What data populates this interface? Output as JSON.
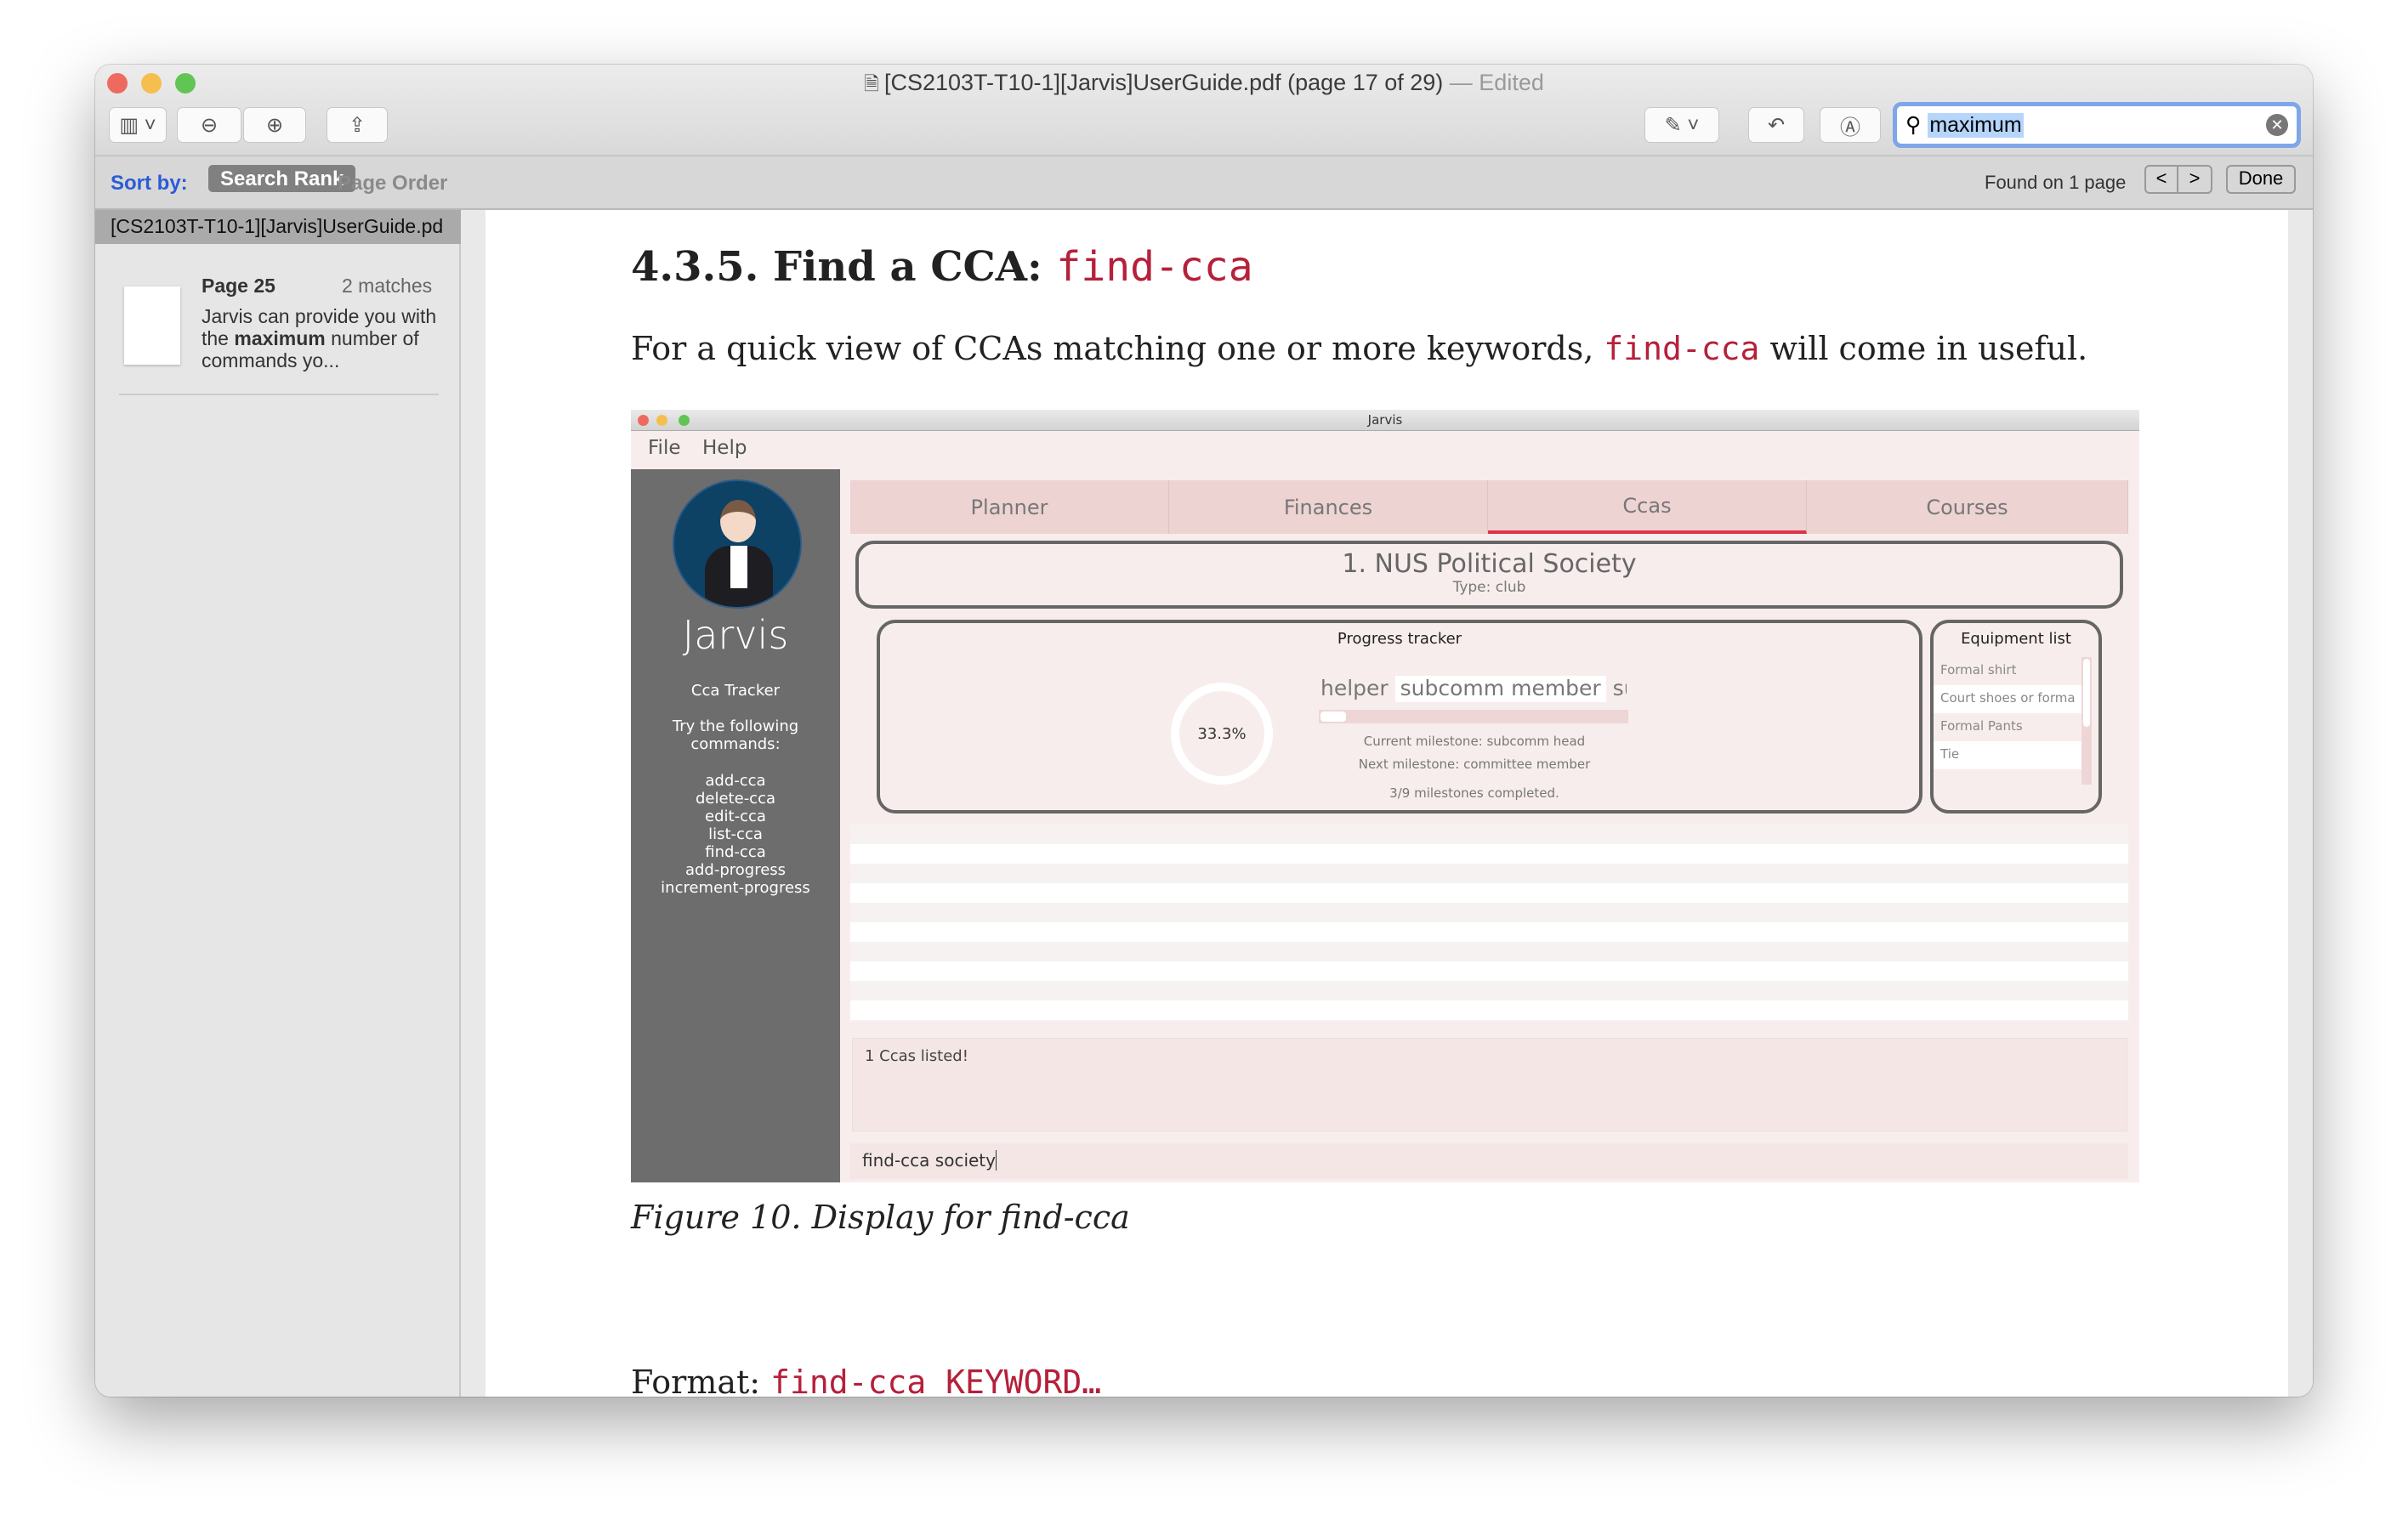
{
  "window": {
    "title": "[CS2103T-T10-1][Jarvis]UserGuide.pdf (page 17 of 29)",
    "edited": "— Edited"
  },
  "toolbar": {
    "icons": [
      "sidebar-icon",
      "zoom-out-icon",
      "zoom-in-icon",
      "share-icon",
      "markup-pen-icon",
      "rotate-icon",
      "annotate-icon"
    ]
  },
  "search": {
    "value": "maximum"
  },
  "sortbar": {
    "label": "Sort by:",
    "search_rank": "Search Rank",
    "page_order": "Page Order",
    "found": "Found on 1 page",
    "prev": "<",
    "next": ">",
    "done": "Done"
  },
  "sidebar": {
    "file": "[CS2103T-T10-1][Jarvis]UserGuide.pd",
    "results": [
      {
        "page": "Page 25",
        "matches": "2 matches",
        "pre": "Jarvis can provide you with the ",
        "hit": "maximum",
        "post": " number of commands yo..."
      }
    ]
  },
  "doc": {
    "heading": "4.3.5. Find a CCA: ",
    "heading_code": "find-cca",
    "para_pre": "For a quick view of CCAs matching one or more keywords, ",
    "para_code": "find-cca",
    "para_post": " will come in useful.",
    "caption": "Figure 10. Display for find-cca",
    "format_label": "Format: ",
    "format_code": "find-cca KEYWORD…"
  },
  "jarvis": {
    "title": "Jarvis",
    "menu": [
      "File",
      "Help"
    ],
    "app_name": "Jarvis",
    "section": "Cca Tracker",
    "hint": [
      "Try the following",
      "commands:"
    ],
    "commands": [
      "add-cca",
      "delete-cca",
      "edit-cca",
      "list-cca",
      "find-cca",
      "add-progress",
      "increment-progress"
    ],
    "tabs": [
      "Planner",
      "Finances",
      "Ccas",
      "Courses"
    ],
    "active_tab": "Ccas",
    "accent": "#e0314b",
    "cca_name": "1.  NUS Political Society",
    "cca_type": "Type: club",
    "progress": {
      "title": "Progress tracker",
      "percent": "33.3%",
      "value": 0.333,
      "milestones": [
        "helper",
        "subcomm member",
        "su"
      ],
      "current": "Current milestone: subcomm head",
      "next": "Next milestone: committee member",
      "completed": "3/9 milestones completed."
    },
    "equipment": {
      "title": "Equipment list",
      "items": [
        "Formal shirt",
        "Court shoes or forma",
        "Formal Pants",
        "Tie"
      ]
    },
    "result": "1 Ccas listed!",
    "command": "find-cca society"
  }
}
